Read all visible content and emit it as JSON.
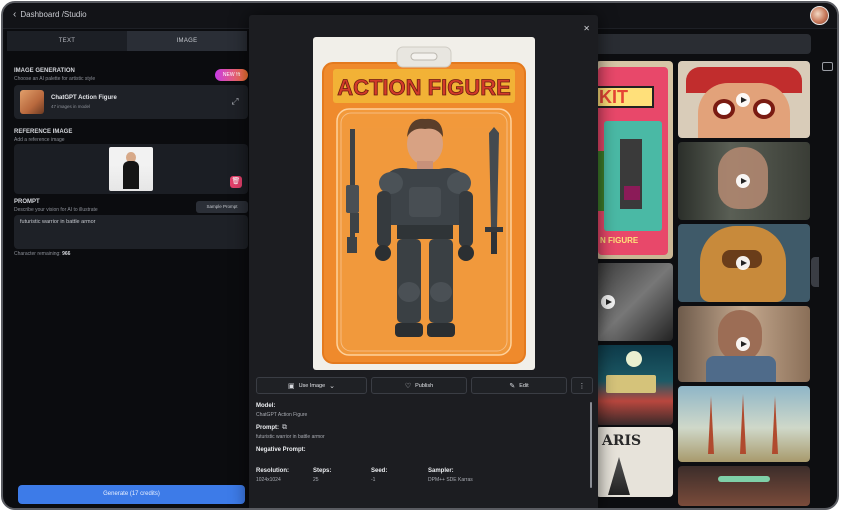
{
  "topbar": {
    "back_label": "Dashboard /Studio"
  },
  "left": {
    "tabs": [
      {
        "label": "TEXT"
      },
      {
        "label": "IMAGE"
      }
    ],
    "image_gen": {
      "title": "IMAGE GENERATION",
      "subtitle": "Choose an AI palette for artistic style",
      "badge": "NEW !ft"
    },
    "model": {
      "name": "ChatGPT Action Figure",
      "count": "47 images in model"
    },
    "reference": {
      "title": "REFERENCE IMAGE",
      "subtitle": "Add a reference image"
    },
    "prompt": {
      "title": "PROMPT",
      "subtitle": "Describe your vision for AI to illustrate",
      "sample_label": "Sample Prompt",
      "value": "futuristic warrior in battle armor"
    },
    "chars": {
      "label": "Character remaining:",
      "value": "966"
    },
    "generate_label": "Generate (17 credits)"
  },
  "modal": {
    "card_title": "ACTION FIGURE",
    "buttons": {
      "use_image": "Use Image",
      "publish": "Publish",
      "edit": "Edit"
    },
    "model_label": "Model:",
    "model_value": "ChatGPT Action Figure",
    "prompt_label": "Prompt:",
    "prompt_value": "futuristic warrior in battle armor",
    "negative_label": "Negative Prompt:",
    "specs": [
      {
        "label": "Resolution:",
        "value": "1024x1024"
      },
      {
        "label": "Steps:",
        "value": "25"
      },
      {
        "label": "Seed:",
        "value": "-1"
      },
      {
        "label": "Sampler:",
        "value": "DPM++ SDE Karras"
      }
    ]
  },
  "gallery": {
    "tiles": [
      {
        "text": "KIT"
      },
      {
        "text": "N FIGURE"
      },
      {
        "text": "ARIS"
      }
    ]
  },
  "colors": {
    "accent": "#3d7be8",
    "card_orange": "#ef8a2c",
    "title_red": "#d33a2a"
  },
  "icons": [
    "chevron-left-icon",
    "swap-icon",
    "trash-icon",
    "image-icon",
    "chevron-down-icon",
    "heart-icon",
    "edit-icon",
    "more-icon",
    "copy-icon",
    "close-icon",
    "play-icon",
    "sidebar-icon"
  ]
}
